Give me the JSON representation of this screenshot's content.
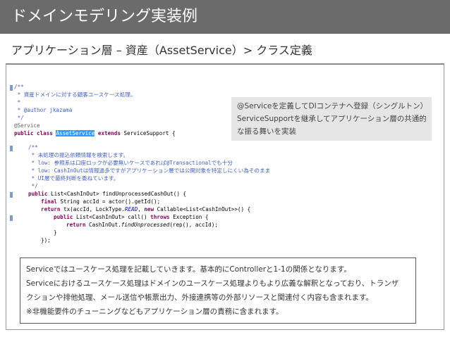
{
  "slide": {
    "title": "ドメインモデリング実装例",
    "subtitle": "アプリケーション層 – 資産（AssetService）> クラス定義"
  },
  "code": {
    "l1": "/**",
    "l2": " * 資産ドメインに対する顧客ユースケース処理。",
    "l3": " *",
    "l4": " * @author jkazama",
    "l5": " */",
    "l6_annotation": "@Service",
    "l7_kw": "public class ",
    "l7_class": "AssetService",
    "l7_ext": " extends ",
    "l7_rest": "ServiceSupport {",
    "l8": "/**",
    "l9": " * 未処理の振込依頼情報を検索します。",
    "l10": " * low: 参照系は口座ロックが必要無いケースであれば@Transactionalでも十分",
    "l11": " * low: CashInOutは情報過多ですがアプリケーション層では公開対象を特定しにくい為そのまま",
    "l12": " * UI層で最終判断を委ねています。",
    "l13": " */",
    "l14_kw": "public ",
    "l14_rest": "List<CashInOut> findUnprocessedCashOut() {",
    "l15_kw": "final ",
    "l15_rest": "String accId = actor().getId();",
    "l16_kw": "return ",
    "l16_a": "tx(accId, LockType.",
    "l16_field": "READ",
    "l16_b": ", ",
    "l16_kw2": "new ",
    "l16_c": "Callable<List<CashInOut>>() {",
    "l17_kw": "public ",
    "l17_a": "List<CashInOut> call() ",
    "l17_kw2": "throws ",
    "l17_b": "Exception {",
    "l18_kw": "return ",
    "l18_a": "CashInOut.",
    "l18_method": "findUnprocessed",
    "l18_b": "(rep(), accId);",
    "l19": "}",
    "l20": "});",
    "l21": "}"
  },
  "callout": {
    "line1": "@Serviceを定義してDIコンテナへ登録（シングルトン）",
    "line2": "ServiceSupportを継承してアプリケーション層の共通的",
    "line3": "な振る舞いを実装"
  },
  "description": {
    "line1": "Serviceではユースケース処理を記載していきます。基本的にControllerと1-1の関係となります。",
    "line2": "Serviceにおけるユースケース処理はドメインのユースケース処理よりもより広義な解釈となっており、トランザ",
    "line3": "クションや排他処理、メール送信や帳票出力、外接連携等の外部リソースと関連付く内容も含まれます。",
    "line4": "※非機能要件のチューニングなどもアプリケーション層の責務に含まれます。"
  },
  "colors": {
    "title_bar": "#6b6b6b",
    "keyword": "#7f0055",
    "comment": "#3f5fbf",
    "highlight": "#3399ff",
    "callout_bg": "#e6e6e6"
  }
}
